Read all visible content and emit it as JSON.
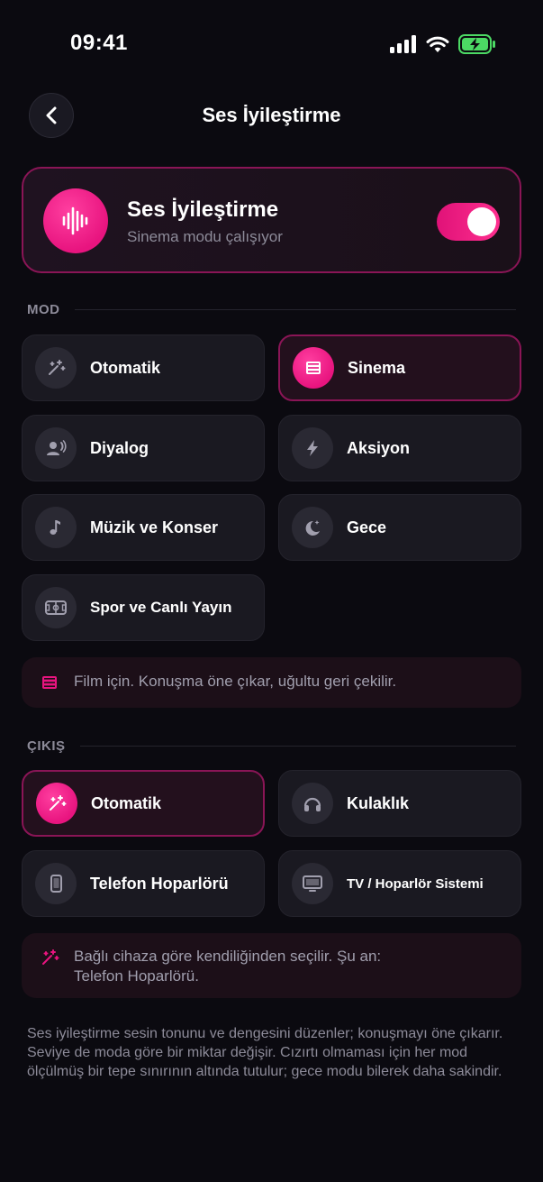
{
  "status": {
    "time": "09:41"
  },
  "header": {
    "title": "Ses İyileştirme"
  },
  "hero": {
    "title": "Ses İyileştirme",
    "subtitle": "Sinema modu çalışıyor",
    "enabled": true
  },
  "mode_section": {
    "label": "MOD",
    "items": [
      {
        "label": "Otomatik",
        "icon": "magic-wand-icon",
        "selected": false
      },
      {
        "label": "Sinema",
        "icon": "film-icon",
        "selected": true
      },
      {
        "label": "Diyalog",
        "icon": "speaker-voice-icon",
        "selected": false
      },
      {
        "label": "Aksiyon",
        "icon": "lightning-icon",
        "selected": false
      },
      {
        "label": "Müzik ve Konser",
        "icon": "music-note-icon",
        "selected": false
      },
      {
        "label": "Gece",
        "icon": "moon-stars-icon",
        "selected": false
      },
      {
        "label": "Spor ve Canlı Yayın",
        "icon": "stadium-icon",
        "selected": false
      }
    ],
    "info": "Film için. Konuşma öne çıkar, uğultu geri çekilir."
  },
  "output_section": {
    "label": "ÇIKIŞ",
    "items": [
      {
        "label": "Otomatik",
        "icon": "magic-wand-icon",
        "selected": true
      },
      {
        "label": "Kulaklık",
        "icon": "headphones-icon",
        "selected": false
      },
      {
        "label": "Telefon Hoparlörü",
        "icon": "phone-icon",
        "selected": false
      },
      {
        "label": "TV / Hoparlör Sistemi",
        "icon": "tv-icon",
        "selected": false
      }
    ],
    "info_line1": "Bağlı cihaza göre kendiliğinden seçilir. Şu an:",
    "info_line2": "Telefon Hoparlörü."
  },
  "footer": "Ses iyileştirme sesin tonunu ve dengesini düzenler; konuşmayı öne çıkarır. Seviye de moda göre bir miktar değişir. Cızırtı olmaması için her mod ölçülmüş bir tepe sınırının altında tutulur; gece modu bilerek daha sakindir.",
  "colors": {
    "accent": "#e8147f",
    "background": "#0b0a10",
    "card": "#1a1921",
    "selected_border": "#8a1556"
  }
}
